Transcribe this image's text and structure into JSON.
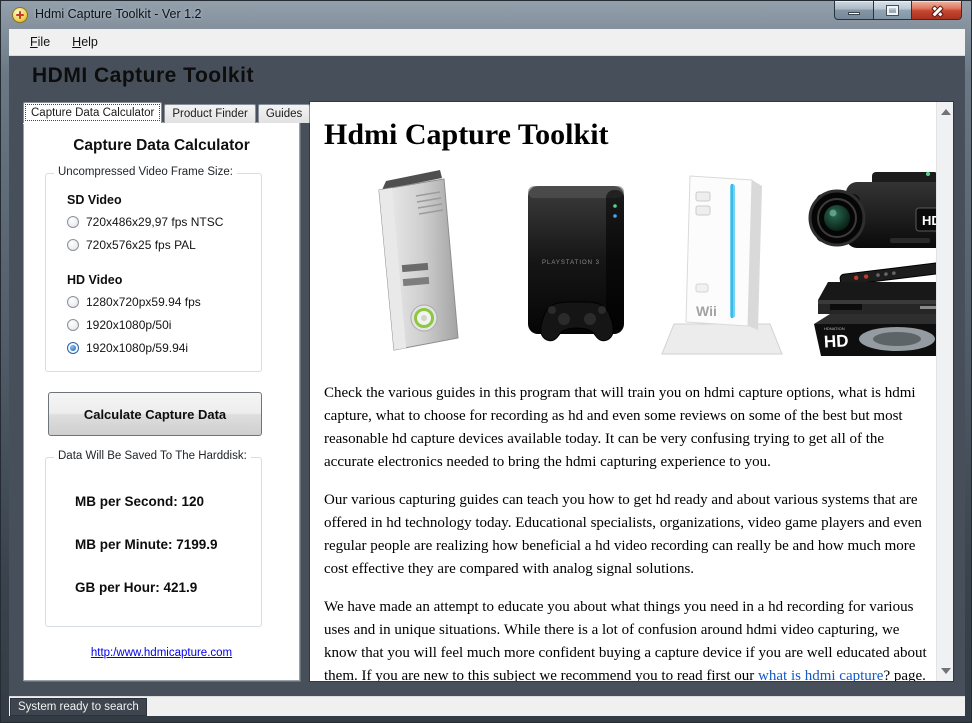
{
  "window": {
    "title": "Hdmi Capture Toolkit - Ver 1.2",
    "icons": {
      "app": "plus-circle-icon",
      "minimize": "minimize-icon",
      "maximize": "maximize-icon",
      "close": "close-icon",
      "scroll_up": "scroll-up-arrow-icon",
      "scroll_down": "scroll-down-arrow-icon"
    }
  },
  "menu": {
    "items": [
      {
        "label": "File"
      },
      {
        "label": "Help"
      }
    ]
  },
  "header": {
    "title": "HDMI Capture Toolkit"
  },
  "tabs": [
    {
      "label": "Capture Data Calculator",
      "active": true
    },
    {
      "label": "Product Finder",
      "active": false
    },
    {
      "label": "Guides",
      "active": false
    }
  ],
  "calculator": {
    "heading": "Capture Data Calculator",
    "frame_size_group": {
      "title": "Uncompressed Video Frame Size:",
      "sd_heading": "SD Video",
      "hd_heading": "HD Video",
      "options": [
        {
          "label": "720x486x29,97 fps NTSC",
          "selected": false
        },
        {
          "label": "720x576x25 fps PAL",
          "selected": false
        },
        {
          "label": "1280x720px59.94 fps",
          "selected": false
        },
        {
          "label": "1920x1080p/50i",
          "selected": false
        },
        {
          "label": "1920x1080p/59.94i",
          "selected": true
        }
      ]
    },
    "calculate_button": "Calculate Capture Data",
    "results_group": {
      "title": "Data Will Be Saved To The Harddisk:",
      "rows": [
        {
          "label": "MB per Second:",
          "value": "120"
        },
        {
          "label": "MB per Minute:",
          "value": "7199.9"
        },
        {
          "label": "GB per Hour:",
          "value": "421.9"
        }
      ]
    },
    "website_link": "http:/www.hdmicapture.com"
  },
  "article": {
    "heading": "Hdmi Capture Toolkit",
    "images": [
      "xbox-360-console",
      "playstation-3-console",
      "nintendo-wii-console",
      "sony-hd-camcorder",
      "hd-capture-receiver-box"
    ],
    "paragraph1": "Check the various guides in this program that will train you on hdmi capture options, what is hdmi capture, what to choose for recording as hd and even some reviews on some of the best but most reasonable hd capture devices available today. It can be very confusing trying to get all of the accurate electronics needed to bring the hdmi capturing experience to you.",
    "paragraph2": "Our various capturing guides can teach you how to get hd ready and about various systems that are offered in hd technology today. Educational specialists, organizations, video game players and even regular people are realizing how beneficial a hd video recording can really be and how much more cost effective they are compared with analog signal solutions.",
    "paragraph3_before": "We have made an attempt to educate you about what things you need in a hd recording for various uses and in unique situations. While there is a lot of confusion around hdmi video capturing, we know that you will feel much more confident buying a capture device if you are well educated about them. If you are new to this subject we recommend you to read first our ",
    "paragraph3_link": "what is hdmi capture",
    "paragraph3_after": "? page."
  },
  "statusbar": {
    "text": "System ready to search"
  },
  "colors": {
    "accent_blue": "#1c5bb6",
    "link_blue": "#0000e6",
    "frame_dark": "#47505a",
    "close_red": "#c64531",
    "wii_slot_blue": "#6fd4f2",
    "xbox_ring_green": "#8dc63f"
  }
}
